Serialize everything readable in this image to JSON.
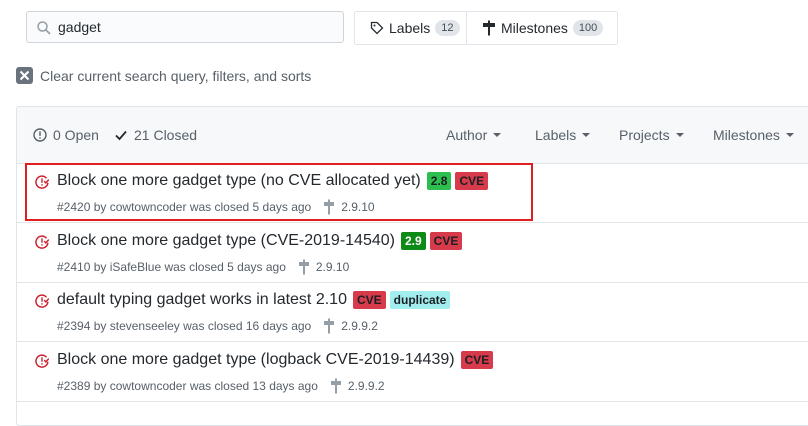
{
  "search": {
    "value": "gadget"
  },
  "toolbar": {
    "labels": {
      "label": "Labels",
      "count": "12"
    },
    "milestones": {
      "label": "Milestones",
      "count": "100"
    }
  },
  "clear_filters": {
    "text": "Clear current search query, filters, and sorts"
  },
  "states": {
    "open": "0 Open",
    "closed": "21 Closed"
  },
  "filters": {
    "author": "Author",
    "labels": "Labels",
    "projects": "Projects",
    "milestones": "Milestones"
  },
  "issues": [
    {
      "title": "Block one more gadget type (no CVE allocated yet)",
      "labels": [
        {
          "text": "2.8",
          "bg": "#2cbe4e",
          "fg": "#1b1f23"
        },
        {
          "text": "CVE",
          "bg": "#d73a4a",
          "fg": "#1b1f23"
        }
      ],
      "number": "#2420",
      "by": "by",
      "author": "cowtowncoder",
      "status": "was closed 5 days ago",
      "milestone": "2.9.10"
    },
    {
      "title": "Block one more gadget type (CVE-2019-14540)",
      "labels": [
        {
          "text": "2.9",
          "bg": "#0e8a16",
          "fg": "#ffffff"
        },
        {
          "text": "CVE",
          "bg": "#d73a4a",
          "fg": "#1b1f23"
        }
      ],
      "number": "#2410",
      "by": "by",
      "author": "iSafeBlue",
      "status": "was closed 5 days ago",
      "milestone": "2.9.10"
    },
    {
      "title": "default typing gadget works in latest 2.10",
      "labels": [
        {
          "text": "CVE",
          "bg": "#d73a4a",
          "fg": "#1b1f23"
        },
        {
          "text": "duplicate",
          "bg": "#a2eeef",
          "fg": "#1b1f23"
        }
      ],
      "number": "#2394",
      "by": "by",
      "author": "stevenseeley",
      "status": "was closed 16 days ago",
      "milestone": "2.9.9.2"
    },
    {
      "title": "Block one more gadget type (logback CVE-2019-14439)",
      "labels": [
        {
          "text": "CVE",
          "bg": "#d73a4a",
          "fg": "#1b1f23"
        }
      ],
      "number": "#2389",
      "by": "by",
      "author": "cowtowncoder",
      "status": "was closed 13 days ago",
      "milestone": "2.9.9.2"
    }
  ],
  "colors": {
    "closed_icon": "#cb2431",
    "highlight": "#e02020"
  }
}
